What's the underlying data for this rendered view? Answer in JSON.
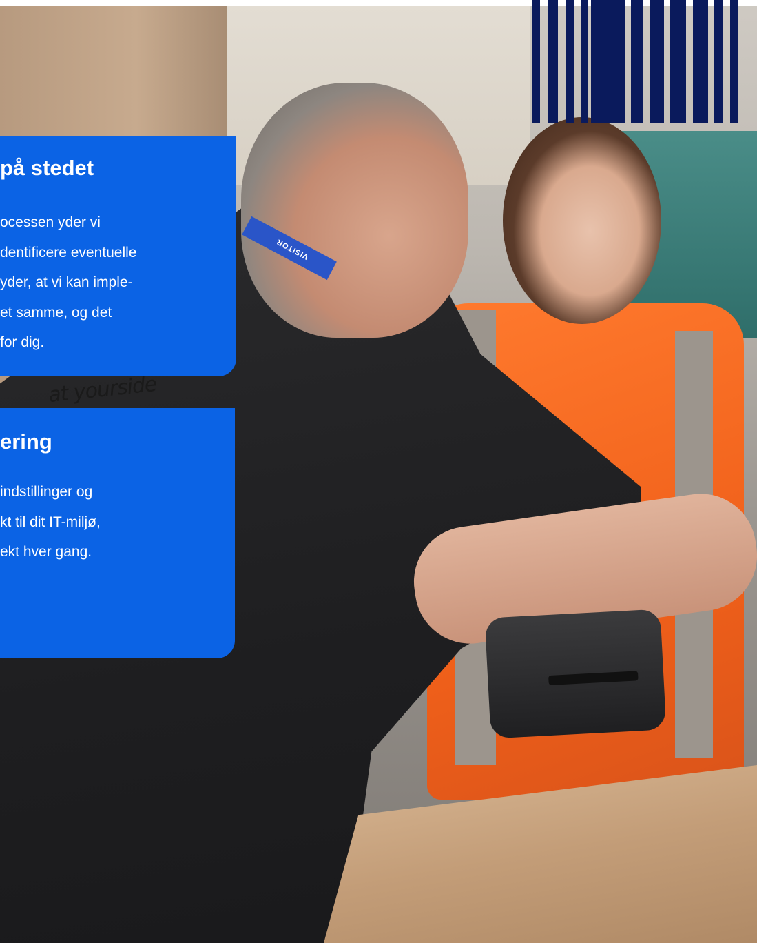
{
  "cards": [
    {
      "title": "på stedet",
      "lines": [
        "ocessen yder vi",
        "dentificere eventuelle",
        "yder, at vi kan imple-",
        "et samme, og det",
        "for dig."
      ]
    },
    {
      "title": "ering",
      "lines": [
        "indstillinger og",
        "kt til dit IT-miljø,",
        "ekt hver gang."
      ]
    }
  ],
  "photo": {
    "lanyard": "VISITOR",
    "tagline": "at yourside"
  },
  "colors": {
    "card_blue": "#0b63e5",
    "barcode_navy": "#0a1a5c"
  }
}
